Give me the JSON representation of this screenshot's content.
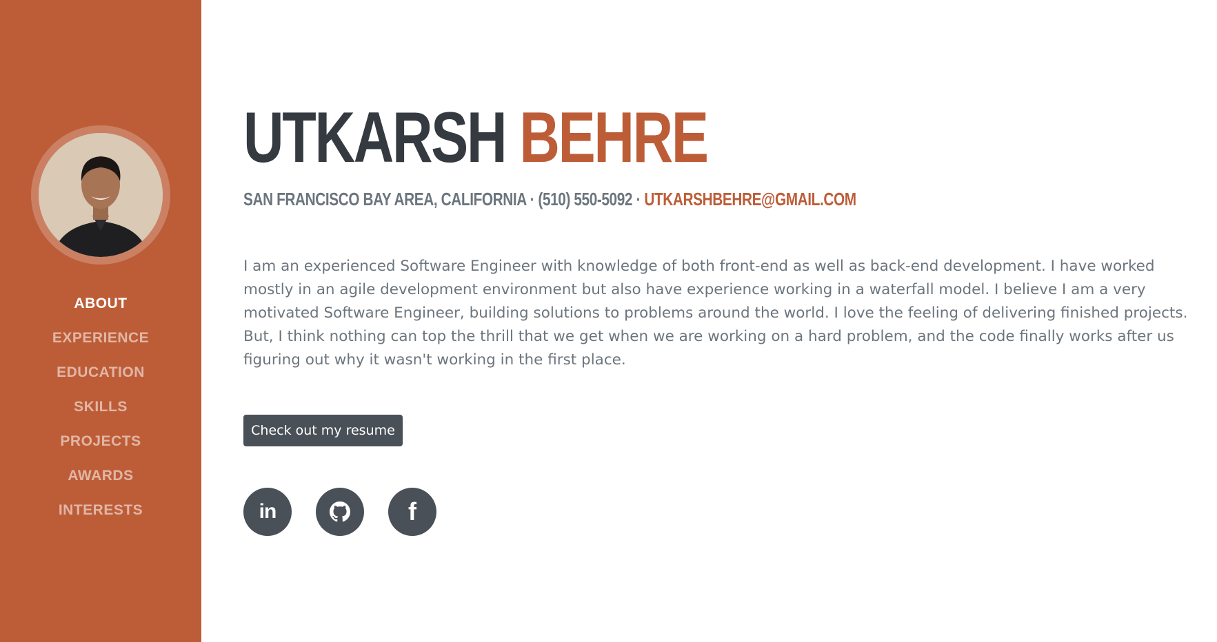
{
  "sidebar": {
    "avatar_alt": "profile photo",
    "nav": [
      {
        "label": "ABOUT",
        "active": true
      },
      {
        "label": "EXPERIENCE",
        "active": false
      },
      {
        "label": "EDUCATION",
        "active": false
      },
      {
        "label": "SKILLS",
        "active": false
      },
      {
        "label": "PROJECTS",
        "active": false
      },
      {
        "label": "AWARDS",
        "active": false
      },
      {
        "label": "INTERESTS",
        "active": false
      }
    ]
  },
  "header": {
    "first_name": "UTKARSH",
    "last_name": "BEHRE",
    "location": "SAN FRANCISCO BAY AREA, CALIFORNIA",
    "separator": " · ",
    "phone": "(510) 550-5092",
    "email": "UTKARSHBEHRE@GMAIL.COM"
  },
  "bio": "I am an experienced Software Engineer with knowledge of both front-end as well as back-end development. I have worked mostly in an agile development environment but also have experience working in a waterfall model. I believe I am a very motivated Software Engineer, building solutions to problems around the world. I love the feeling of delivering finished projects. But, I think nothing can top the thrill that we get when we are working on a hard problem, and the code finally works after us figuring out why it wasn't working in the first place.",
  "resume_button": "Check out my resume",
  "social": {
    "linkedin_label": "in",
    "github_icon": "github-icon",
    "facebook_label": "f"
  },
  "colors": {
    "accent": "#bd5d38",
    "dark": "#343a40",
    "muted": "#6c757d",
    "button": "#495057"
  }
}
